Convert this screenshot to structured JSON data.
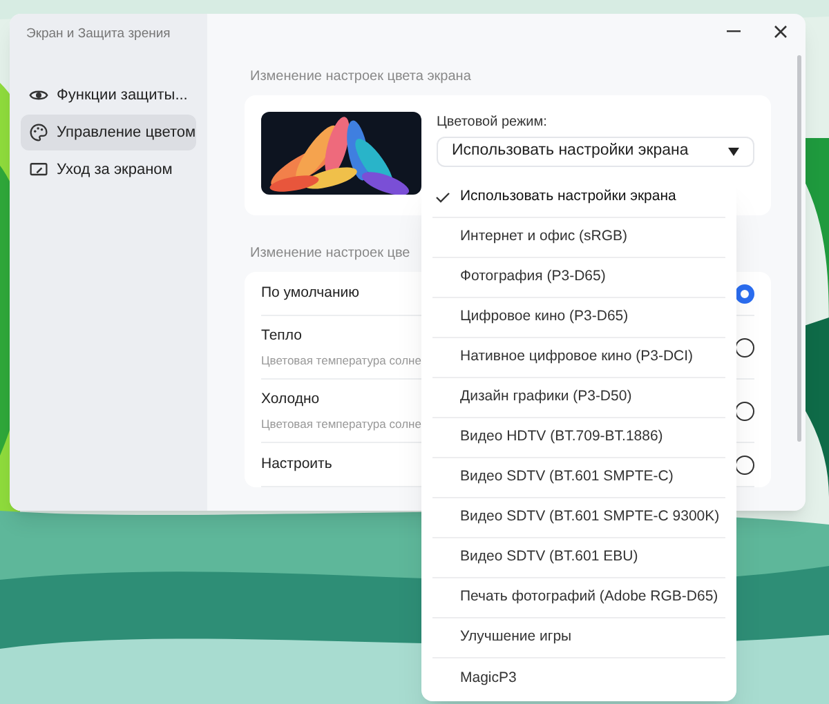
{
  "window": {
    "title": "Экран и Защита зрения"
  },
  "sidebar": {
    "items": [
      {
        "label": "Функции защиты...",
        "kind": "eye",
        "selected": false
      },
      {
        "label": "Управление цветом",
        "kind": "palette",
        "selected": true
      },
      {
        "label": "Уход за экраном",
        "kind": "screen",
        "selected": false
      }
    ]
  },
  "color_section": {
    "title": "Изменение настроек цвета экрана",
    "mode_label": "Цветовой режим:",
    "mode_value": "Использовать настройки экрана",
    "expanded": true
  },
  "temperature_section": {
    "title": "Изменение настроек цве",
    "options": [
      {
        "label": "По умолчанию",
        "selected": true
      },
      {
        "label": "Тепло",
        "description": "Цветовая температура солне",
        "selected": false
      },
      {
        "label": "Холодно",
        "description": "Цветовая температура солне",
        "selected": false
      },
      {
        "label": "Настроить",
        "selected": false
      }
    ]
  },
  "mode_menu": [
    {
      "label": "Использовать настройки экрана",
      "selected": true
    },
    {
      "label": "Интернет и офис (sRGB)",
      "selected": false
    },
    {
      "label": "Фотография (P3-D65)",
      "selected": false
    },
    {
      "label": "Цифровое кино (P3-D65)",
      "selected": false
    },
    {
      "label": "Нативное цифровое кино (P3-DCI)",
      "selected": false
    },
    {
      "label": "Дизайн графики (P3-D50)",
      "selected": false
    },
    {
      "label": "Видео HDTV (BT.709-BT.1886)",
      "selected": false
    },
    {
      "label": "Видео SDTV (BT.601 SMPTE-C)",
      "selected": false
    },
    {
      "label": "Видео SDTV (BT.601 SMPTE-C 9300K)",
      "selected": false
    },
    {
      "label": "Видео SDTV (BT.601 EBU)",
      "selected": false
    },
    {
      "label": "Печать фотографий (Adobe RGB-D65)",
      "selected": false
    },
    {
      "label": "Улучшение игры",
      "selected": false
    },
    {
      "label": "MagicP3",
      "selected": false
    }
  ]
}
